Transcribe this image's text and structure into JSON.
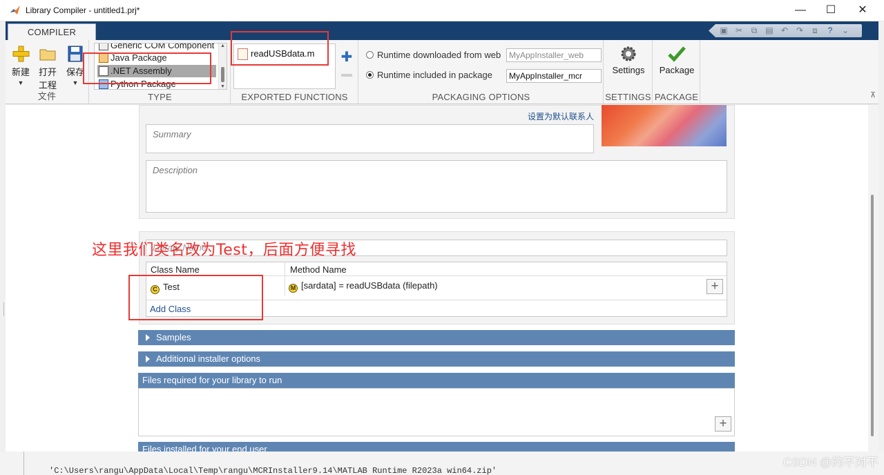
{
  "window": {
    "title": "Library Compiler - untitled1.prj*",
    "minimize": "—",
    "maximize": "☐",
    "close": "✕"
  },
  "tab": {
    "label": "COMPILER"
  },
  "ribbon": {
    "file": {
      "new_label": "新建",
      "open_label_1": "打开",
      "open_label_2": "工程",
      "save_label": "保存",
      "section": "文件"
    },
    "type": {
      "items": [
        "Generic COM Component",
        "Java Package",
        ".NET Assembly",
        "Python Package"
      ],
      "selected": ".NET Assembly",
      "section": "TYPE"
    },
    "exported": {
      "file": "readUSBdata.m",
      "section": "EXPORTED FUNCTIONS"
    },
    "packaging": {
      "web_label": "Runtime downloaded from web",
      "web_value": "MyAppInstaller_web",
      "included_label": "Runtime included in package",
      "included_value": "MyAppInstaller_mcr",
      "selected": "included",
      "section": "PACKAGING OPTIONS"
    },
    "settings": {
      "label": "Settings",
      "section": "SETTINGS"
    },
    "package": {
      "label": "Package",
      "section": "PACKAGE"
    }
  },
  "main": {
    "default_contact_link": "设置为默认联系人",
    "summary_placeholder": "Summary",
    "description_placeholder": "Description",
    "library_name_placeholder": "Library Name",
    "table": {
      "headers": {
        "class": "Class Name",
        "method": "Method Name"
      },
      "rows": [
        {
          "class": "Test",
          "method": "[sardata] = readUSBdata (filepath)"
        }
      ],
      "add_class": "Add Class"
    },
    "sections": {
      "samples": "Samples",
      "additional": "Additional installer options",
      "files_required": "Files required for your library to run",
      "files_installed": "Files installed for your end user"
    }
  },
  "annotation": "这里我们类名改为Test，后面方便寻找",
  "footer_path": "'C:\\Users\\rangu\\AppData\\Local\\Temp\\rangu\\MCRInstaller9.14\\MATLAB Runtime R2023a win64.zip'",
  "watermark": "CSDN @的不对不",
  "colors": {
    "titlebar_tab": "#17406f",
    "section_bar": "#5f86b3",
    "annotation": "#ee2e2e",
    "link": "#1f4f8e"
  }
}
